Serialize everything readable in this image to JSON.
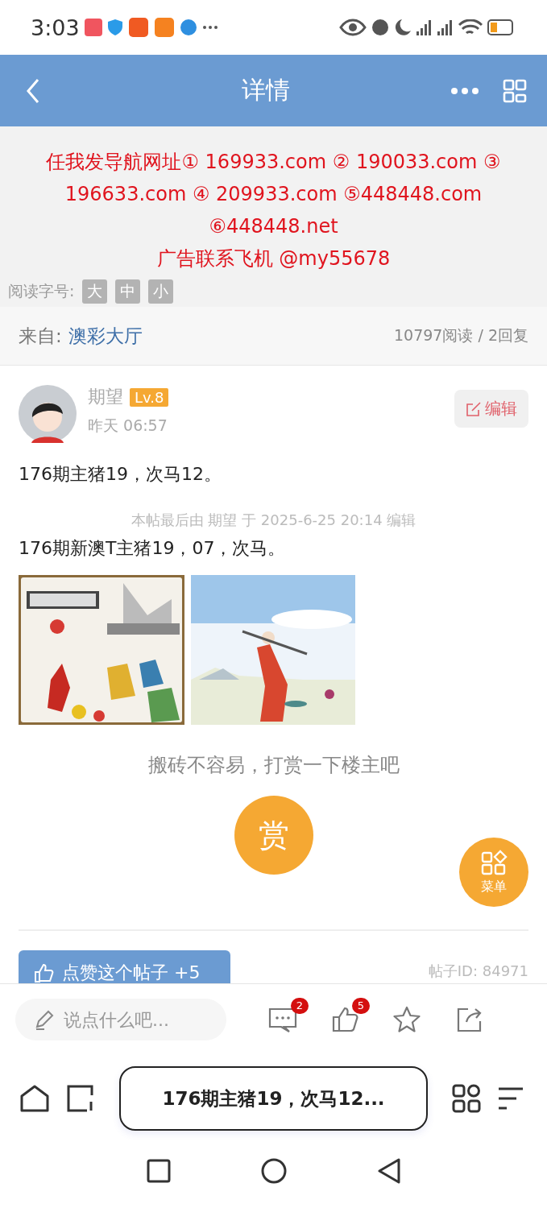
{
  "status_bar": {
    "time": "3:03"
  },
  "header": {
    "title": "详情"
  },
  "notice": {
    "lines": [
      "任我发导航网址① 169933.com ② 190033.com ③",
      "196633.com ④ 209933.com ⑤448448.com",
      "⑥448448.net",
      "广告联系飞机 @my55678"
    ]
  },
  "font_size": {
    "label": "阅读字号:",
    "options": [
      {
        "label": "大"
      },
      {
        "label": "中"
      },
      {
        "label": "小"
      }
    ]
  },
  "source": {
    "label": "来自:",
    "forum": "澳彩大厅",
    "stats": "10797阅读 / 2回复"
  },
  "post": {
    "author": "期望",
    "level": "Lv.8",
    "time": "昨天 06:57",
    "edit_button": "编辑",
    "body": "176期主猪19，次马12。",
    "edit_note": "本帖最后由 期望 于 2025-6-25 20:14 编辑",
    "body_2": "176期新澳T主猪19，07，次马。"
  },
  "reward": {
    "prompt": "搬砖不容易，打赏一下楼主吧",
    "button": "赏"
  },
  "float_menu": {
    "label": "菜单"
  },
  "like_button": "点赞这个帖子 +5",
  "post_id": "帖子ID: 84971",
  "bottom_bar": {
    "placeholder": "说点什么吧...",
    "comments_badge": "2",
    "likes_badge": "5"
  },
  "browser_bar": {
    "title": "176期主猪19，次马12..."
  }
}
